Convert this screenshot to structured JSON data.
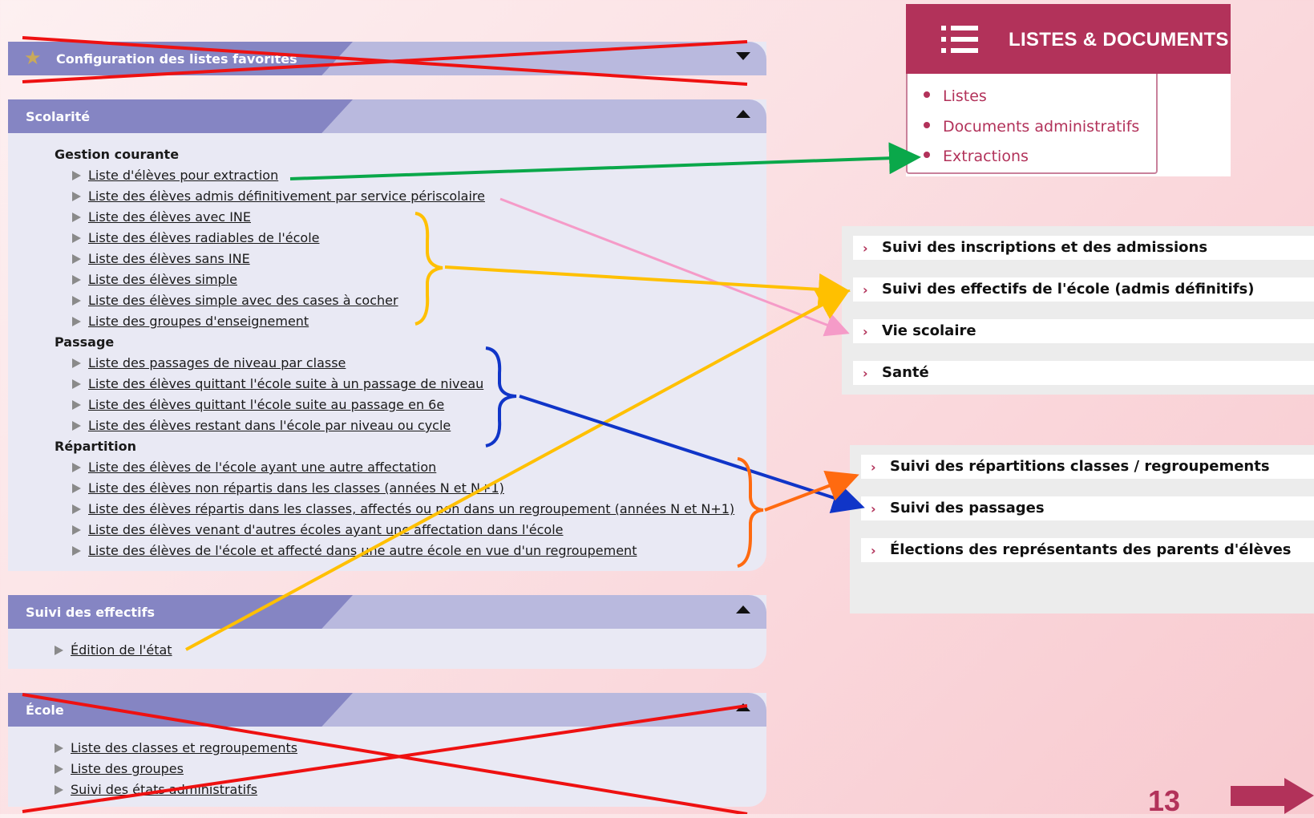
{
  "left_panels": {
    "favorites": {
      "title": "Configuration des listes favorites",
      "icon": "star-icon"
    },
    "scolarite": {
      "title": "Scolarité",
      "groups": [
        {
          "title": "Gestion courante",
          "items": [
            "Liste d'élèves pour extraction",
            "Liste des élèves admis définitivement par service périscolaire",
            "Liste des élèves avec INE",
            "Liste des élèves radiables de l'école",
            "Liste des élèves sans INE",
            "Liste des élèves simple",
            "Liste des élèves simple avec des cases à cocher",
            "Liste des groupes d'enseignement"
          ]
        },
        {
          "title": "Passage",
          "items": [
            "Liste des passages de niveau par classe",
            "Liste des élèves quittant l'école suite à un passage de niveau",
            "Liste des élèves quittant l'école suite au passage en 6e",
            "Liste des élèves restant dans l'école par niveau ou cycle"
          ]
        },
        {
          "title": "Répartition",
          "items": [
            "Liste des élèves de l'école ayant une autre affectation",
            "Liste des élèves non répartis dans les classes (années N et N+1)",
            "Liste des élèves répartis dans les classes, affectés ou non dans un regroupement (années N et N+1)",
            "Liste des élèves venant d'autres écoles ayant une affectation dans l'école",
            "Liste des élèves de l'école et affecté dans une autre école en vue d'un regroupement"
          ]
        }
      ]
    },
    "suivi_effectifs": {
      "title": "Suivi des effectifs",
      "items": [
        "Édition de l'état"
      ]
    },
    "ecole": {
      "title": "École",
      "items": [
        "Liste des classes et regroupements",
        "Liste des groupes",
        "Suivi des états administratifs"
      ]
    }
  },
  "listes_documents": {
    "title": "LISTES & DOCUMENTS",
    "icon": "list-icon",
    "items": [
      "Listes",
      "Documents administratifs",
      "Extractions"
    ]
  },
  "accordion_top": [
    "Suivi des inscriptions et des admissions",
    "Suivi des effectifs de l'école (admis définitifs)",
    "Vie scolaire",
    "Santé"
  ],
  "accordion_bottom": [
    "Suivi des répartitions classes / regroupements",
    "Suivi des passages",
    "Élections des représentants des parents d'élèves"
  ],
  "page_number": "13",
  "colors": {
    "brand": "#b2325a",
    "panel_tab": "#8585c3",
    "panel_header": "#b9b9de",
    "panel_body": "#e9e9f4",
    "cross_out": "#ee1111",
    "arrow_green": "#0aa84a",
    "arrow_pink": "#f59bc8",
    "arrow_yellow": "#ffc000",
    "arrow_blue": "#1035c8",
    "arrow_orange": "#ff6a10"
  }
}
